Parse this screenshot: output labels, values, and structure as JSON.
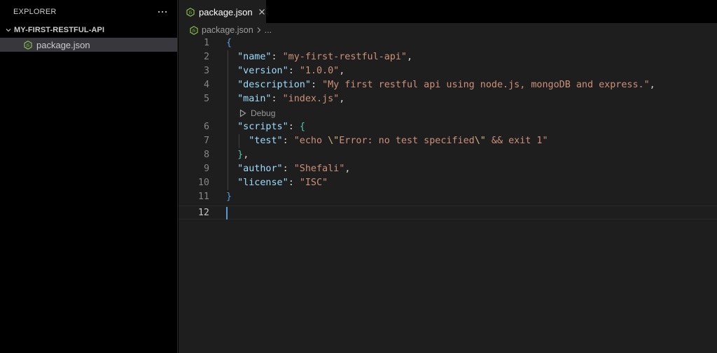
{
  "explorer": {
    "title": "EXPLORER",
    "more_label": "···",
    "folder": "MY-FIRST-RESTFUL-API",
    "files": [
      {
        "name": "package.json",
        "icon": "nodejs-icon"
      }
    ]
  },
  "tabs": [
    {
      "label": "package.json",
      "icon": "nodejs-icon",
      "close": "✕"
    }
  ],
  "breadcrumb": {
    "file": "package.json",
    "separator": "chevron-right-icon",
    "more": "..."
  },
  "editor": {
    "active_line": 12,
    "codelens": {
      "label": "Debug",
      "icon": "play-icon"
    },
    "lines": [
      {
        "num": "1",
        "parts": [
          [
            "b1",
            "{"
          ]
        ]
      },
      {
        "num": "2",
        "parts": [
          [
            "p",
            "  "
          ],
          [
            "k",
            "\"name\""
          ],
          [
            "p",
            ": "
          ],
          [
            "s",
            "\"my-first-restful-api\""
          ],
          [
            "p",
            ","
          ]
        ]
      },
      {
        "num": "3",
        "parts": [
          [
            "p",
            "  "
          ],
          [
            "k",
            "\"version\""
          ],
          [
            "p",
            ": "
          ],
          [
            "s",
            "\"1.0.0\""
          ],
          [
            "p",
            ","
          ]
        ]
      },
      {
        "num": "4",
        "parts": [
          [
            "p",
            "  "
          ],
          [
            "k",
            "\"description\""
          ],
          [
            "p",
            ": "
          ],
          [
            "s",
            "\"My first restful api using node.js, mongoDB and express.\""
          ],
          [
            "p",
            ","
          ]
        ]
      },
      {
        "num": "5",
        "parts": [
          [
            "p",
            "  "
          ],
          [
            "k",
            "\"main\""
          ],
          [
            "p",
            ": "
          ],
          [
            "s",
            "\"index.js\""
          ],
          [
            "p",
            ","
          ]
        ]
      },
      {
        "num": "6",
        "parts": [
          [
            "p",
            "  "
          ],
          [
            "k",
            "\"scripts\""
          ],
          [
            "p",
            ": "
          ],
          [
            "b2",
            "{"
          ]
        ]
      },
      {
        "num": "7",
        "parts": [
          [
            "p",
            "    "
          ],
          [
            "k",
            "\"test\""
          ],
          [
            "p",
            ": "
          ],
          [
            "s",
            "\"echo "
          ],
          [
            "esc",
            "\\\""
          ],
          [
            "s",
            "Error: no test specified"
          ],
          [
            "esc",
            "\\\""
          ],
          [
            "s",
            " && exit 1\""
          ]
        ]
      },
      {
        "num": "8",
        "parts": [
          [
            "p",
            "  "
          ],
          [
            "b2",
            "}"
          ],
          [
            "p",
            ","
          ]
        ]
      },
      {
        "num": "9",
        "parts": [
          [
            "p",
            "  "
          ],
          [
            "k",
            "\"author\""
          ],
          [
            "p",
            ": "
          ],
          [
            "s",
            "\"Shefali\""
          ],
          [
            "p",
            ","
          ]
        ]
      },
      {
        "num": "10",
        "parts": [
          [
            "p",
            "  "
          ],
          [
            "k",
            "\"license\""
          ],
          [
            "p",
            ": "
          ],
          [
            "s",
            "\"ISC\""
          ]
        ]
      },
      {
        "num": "11",
        "parts": [
          [
            "b1",
            "}"
          ]
        ]
      },
      {
        "num": "12",
        "parts": []
      }
    ]
  },
  "colors": {
    "key": "#9cdcfe",
    "string": "#ce9178",
    "bracket_outer": "#569cd6",
    "bracket_inner": "#4ec9b0",
    "escape": "#d7ba7d",
    "node_green": "#8cc84b"
  }
}
